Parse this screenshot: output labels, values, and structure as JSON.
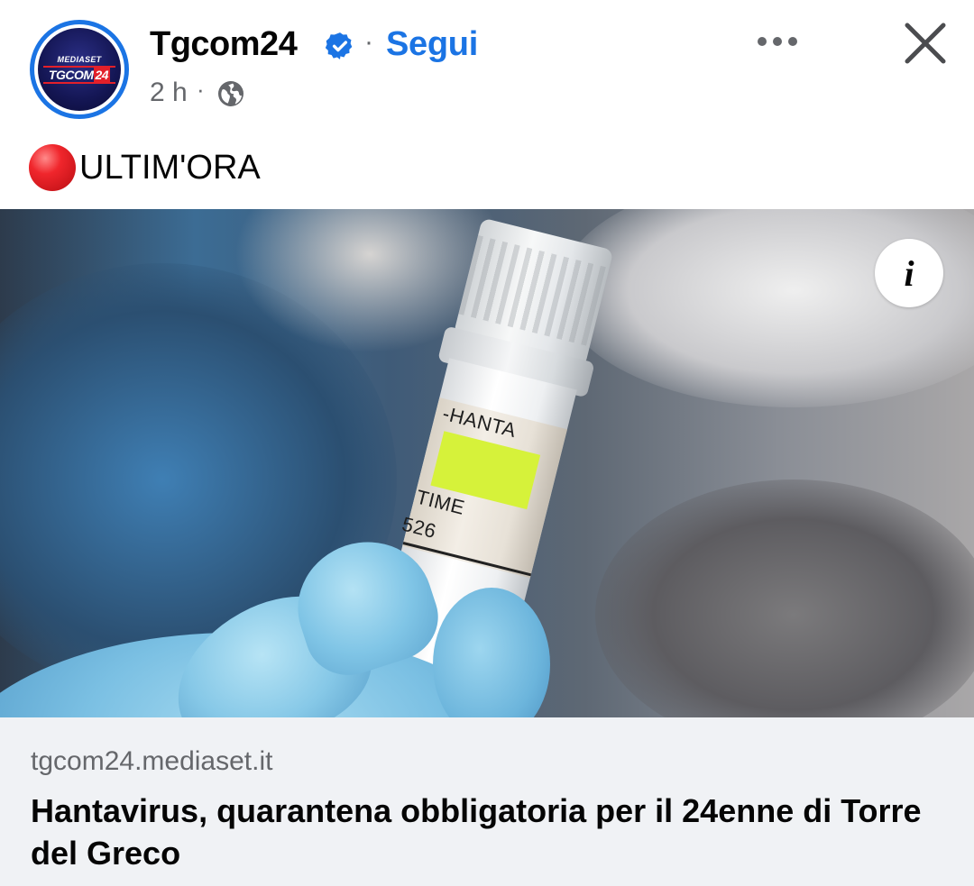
{
  "header": {
    "page_name": "Tgcom24",
    "separator": "·",
    "follow_label": "Segui",
    "timestamp": "2 h",
    "time_separator": "·",
    "logo": {
      "top_text": "MEDIASET",
      "main_text": "TGCOM",
      "main_num": "24"
    },
    "icons": {
      "verified": "verified-badge-icon",
      "audience": "globe-icon",
      "more": "more-horizontal-icon",
      "close": "close-icon"
    }
  },
  "post": {
    "emoji": "red-circle",
    "text": "ULTIM'ORA"
  },
  "media": {
    "tube_label_line1": "-HANTA",
    "tube_label_line2": "TIME",
    "tube_label_line3": "526",
    "info_button": "i"
  },
  "link_preview": {
    "domain": "tgcom24.mediaset.it",
    "title": "Hantavirus, quarantena obbligatoria per il 24enne di Torre del Greco"
  },
  "colors": {
    "brand_blue": "#1b74e4",
    "secondary_text": "#65676b",
    "primary_text": "#050505",
    "card_background": "#f0f2f5"
  }
}
